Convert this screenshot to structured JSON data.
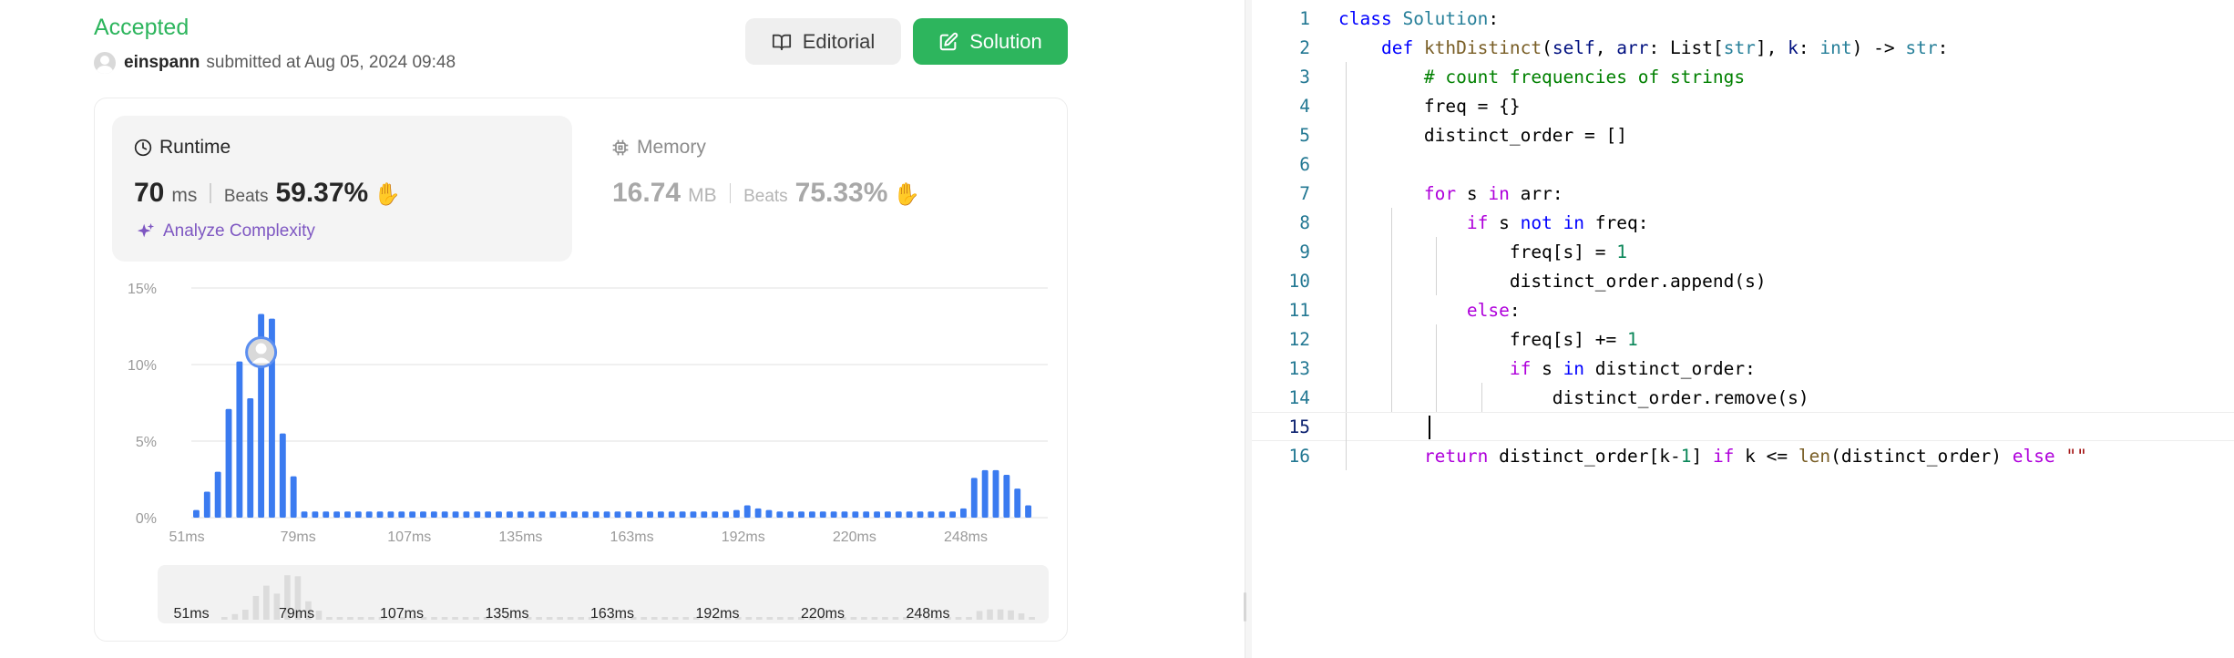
{
  "submission": {
    "status": "Accepted",
    "username": "einspann",
    "submitted_text": "submitted at Aug 05, 2024 09:48"
  },
  "buttons": {
    "editorial": "Editorial",
    "solution": "Solution"
  },
  "runtime": {
    "title": "Runtime",
    "value": "70",
    "unit": "ms",
    "beats_label": "Beats",
    "beats_pct": "59.37%"
  },
  "memory": {
    "title": "Memory",
    "value": "16.74",
    "unit": "MB",
    "beats_label": "Beats",
    "beats_pct": "75.33%"
  },
  "analyze_link": "Analyze Complexity",
  "colors": {
    "accepted": "#2db55d",
    "bar": "#3b7bf0",
    "analyze": "#7e57c2"
  },
  "chart_data": {
    "type": "bar",
    "x_tick_labels": [
      "51ms",
      "79ms",
      "107ms",
      "135ms",
      "163ms",
      "192ms",
      "220ms",
      "248ms"
    ],
    "y_tick_labels": [
      "0%",
      "5%",
      "10%",
      "15%"
    ],
    "ylim": [
      0,
      15
    ],
    "grid": true,
    "values": [
      0.5,
      1.7,
      3.0,
      7.1,
      10.2,
      7.8,
      13.3,
      13.0,
      5.5,
      2.7,
      0.4,
      0.4,
      0.4,
      0.4,
      0.4,
      0.4,
      0.4,
      0.4,
      0.4,
      0.4,
      0.4,
      0.4,
      0.4,
      0.4,
      0.4,
      0.4,
      0.4,
      0.4,
      0.4,
      0.4,
      0.4,
      0.4,
      0.4,
      0.4,
      0.4,
      0.4,
      0.4,
      0.4,
      0.4,
      0.4,
      0.4,
      0.4,
      0.4,
      0.4,
      0.4,
      0.4,
      0.4,
      0.4,
      0.4,
      0.4,
      0.5,
      0.8,
      0.6,
      0.5,
      0.4,
      0.4,
      0.4,
      0.4,
      0.4,
      0.4,
      0.4,
      0.4,
      0.4,
      0.4,
      0.4,
      0.4,
      0.4,
      0.4,
      0.4,
      0.4,
      0.4,
      0.6,
      2.6,
      3.1,
      3.1,
      2.8,
      1.9,
      0.8
    ],
    "user_bar_index": 6
  },
  "editor": {
    "line_numbers": [
      "1",
      "2",
      "3",
      "4",
      "5",
      "6",
      "7",
      "8",
      "9",
      "10",
      "11",
      "12",
      "13",
      "14",
      "15",
      "16"
    ],
    "current_line": 15,
    "lines": [
      [
        {
          "t": "class ",
          "c": "kw-blue"
        },
        {
          "t": "Solution",
          "c": "cls"
        },
        {
          "t": ":",
          "c": ""
        }
      ],
      [
        {
          "t": "    ",
          "c": ""
        },
        {
          "t": "def ",
          "c": "kw-blue"
        },
        {
          "t": "kthDistinct",
          "c": "fn"
        },
        {
          "t": "(",
          "c": ""
        },
        {
          "t": "self",
          "c": "param"
        },
        {
          "t": ", ",
          "c": ""
        },
        {
          "t": "arr",
          "c": "param"
        },
        {
          "t": ": List[",
          "c": ""
        },
        {
          "t": "str",
          "c": "builtin"
        },
        {
          "t": "], ",
          "c": ""
        },
        {
          "t": "k",
          "c": "param"
        },
        {
          "t": ": ",
          "c": ""
        },
        {
          "t": "int",
          "c": "builtin"
        },
        {
          "t": ") -> ",
          "c": ""
        },
        {
          "t": "str",
          "c": "builtin"
        },
        {
          "t": ":",
          "c": ""
        }
      ],
      [
        {
          "t": "        ",
          "c": ""
        },
        {
          "t": "# count frequencies of strings",
          "c": "comment"
        }
      ],
      [
        {
          "t": "        freq = {}",
          "c": ""
        }
      ],
      [
        {
          "t": "        distinct_order = []",
          "c": ""
        }
      ],
      [
        {
          "t": "",
          "c": ""
        }
      ],
      [
        {
          "t": "        ",
          "c": ""
        },
        {
          "t": "for",
          "c": "kw-purple"
        },
        {
          "t": " s ",
          "c": ""
        },
        {
          "t": "in",
          "c": "kw-purple"
        },
        {
          "t": " arr:",
          "c": ""
        }
      ],
      [
        {
          "t": "            ",
          "c": ""
        },
        {
          "t": "if",
          "c": "kw-purple"
        },
        {
          "t": " s ",
          "c": ""
        },
        {
          "t": "not in",
          "c": "kw-blue"
        },
        {
          "t": " freq:",
          "c": ""
        }
      ],
      [
        {
          "t": "                freq[s] = ",
          "c": ""
        },
        {
          "t": "1",
          "c": "num"
        }
      ],
      [
        {
          "t": "                distinct_order.append(s)",
          "c": ""
        }
      ],
      [
        {
          "t": "            ",
          "c": ""
        },
        {
          "t": "else",
          "c": "kw-purple"
        },
        {
          "t": ":",
          "c": ""
        }
      ],
      [
        {
          "t": "                freq[s] += ",
          "c": ""
        },
        {
          "t": "1",
          "c": "num"
        }
      ],
      [
        {
          "t": "                ",
          "c": ""
        },
        {
          "t": "if",
          "c": "kw-purple"
        },
        {
          "t": " s ",
          "c": ""
        },
        {
          "t": "in",
          "c": "kw-blue"
        },
        {
          "t": " distinct_order:",
          "c": ""
        }
      ],
      [
        {
          "t": "                    distinct_order.remove(s)",
          "c": ""
        }
      ],
      [
        {
          "t": "        ",
          "c": ""
        }
      ],
      [
        {
          "t": "        ",
          "c": ""
        },
        {
          "t": "return",
          "c": "kw-purple"
        },
        {
          "t": " distinct_order[k-",
          "c": ""
        },
        {
          "t": "1",
          "c": "num"
        },
        {
          "t": "] ",
          "c": ""
        },
        {
          "t": "if",
          "c": "kw-purple"
        },
        {
          "t": " k <= ",
          "c": ""
        },
        {
          "t": "len",
          "c": "fn"
        },
        {
          "t": "(distinct_order) ",
          "c": ""
        },
        {
          "t": "else",
          "c": "kw-purple"
        },
        {
          "t": " ",
          "c": ""
        },
        {
          "t": "\"\"",
          "c": "str"
        }
      ]
    ]
  }
}
